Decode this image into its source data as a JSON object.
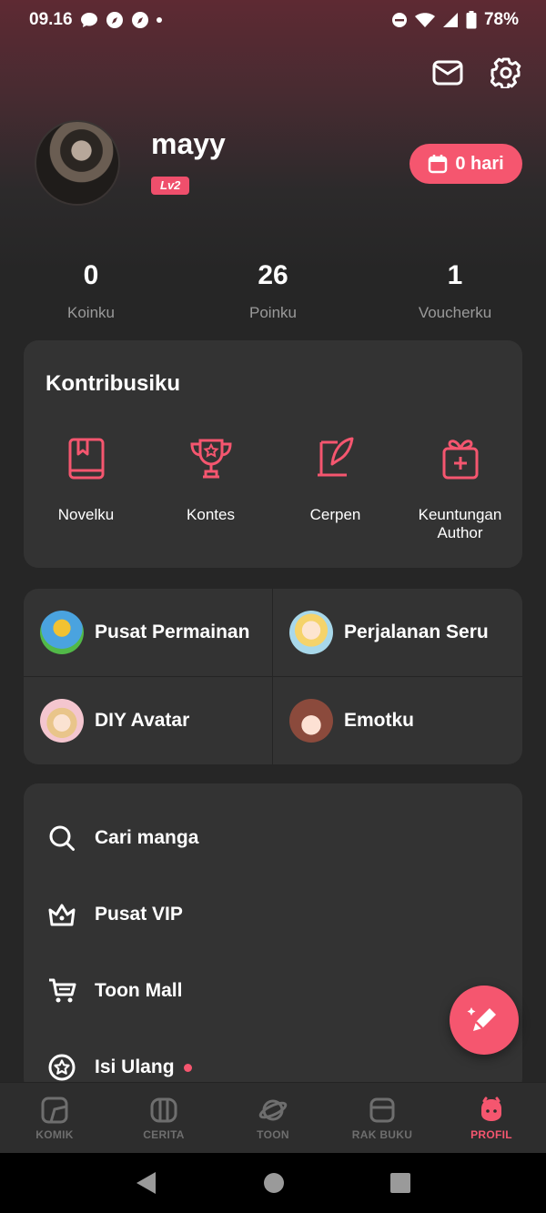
{
  "status_bar": {
    "time": "09.16",
    "battery": "78%"
  },
  "header": {
    "mail_icon": "envelope-icon",
    "settings_icon": "gear-icon"
  },
  "profile": {
    "username": "mayy",
    "level": "Lv2",
    "checkin_label": "0 hari"
  },
  "stats": [
    {
      "value": "0",
      "label": "Koinku"
    },
    {
      "value": "26",
      "label": "Poinku"
    },
    {
      "value": "1",
      "label": "Voucherku"
    }
  ],
  "contributions": {
    "title": "Kontribusiku",
    "items": [
      {
        "label": "Novelku",
        "icon": "book-icon"
      },
      {
        "label": "Kontes",
        "icon": "trophy-icon"
      },
      {
        "label": "Cerpen",
        "icon": "quill-icon"
      },
      {
        "label": "Keuntungan\nAuthor",
        "icon": "gift-icon"
      }
    ]
  },
  "games": [
    {
      "label": "Pusat Permainan"
    },
    {
      "label": "Perjalanan Seru"
    },
    {
      "label": "DIY Avatar"
    },
    {
      "label": "Emotku"
    }
  ],
  "menu": [
    {
      "label": "Cari manga",
      "icon": "search-icon"
    },
    {
      "label": "Pusat VIP",
      "icon": "crown-icon"
    },
    {
      "label": "Toon Mall",
      "icon": "cart-icon"
    },
    {
      "label": "Isi Ulang",
      "icon": "star-coin-icon"
    }
  ],
  "bottom_nav": [
    {
      "label": "KOMIK",
      "active": false
    },
    {
      "label": "CERITA",
      "active": false
    },
    {
      "label": "TOON",
      "active": false
    },
    {
      "label": "RAK BUKU",
      "active": false
    },
    {
      "label": "PROFIL",
      "active": true
    }
  ],
  "colors": {
    "accent": "#f5566f",
    "card": "#333333",
    "background": "#262626"
  }
}
